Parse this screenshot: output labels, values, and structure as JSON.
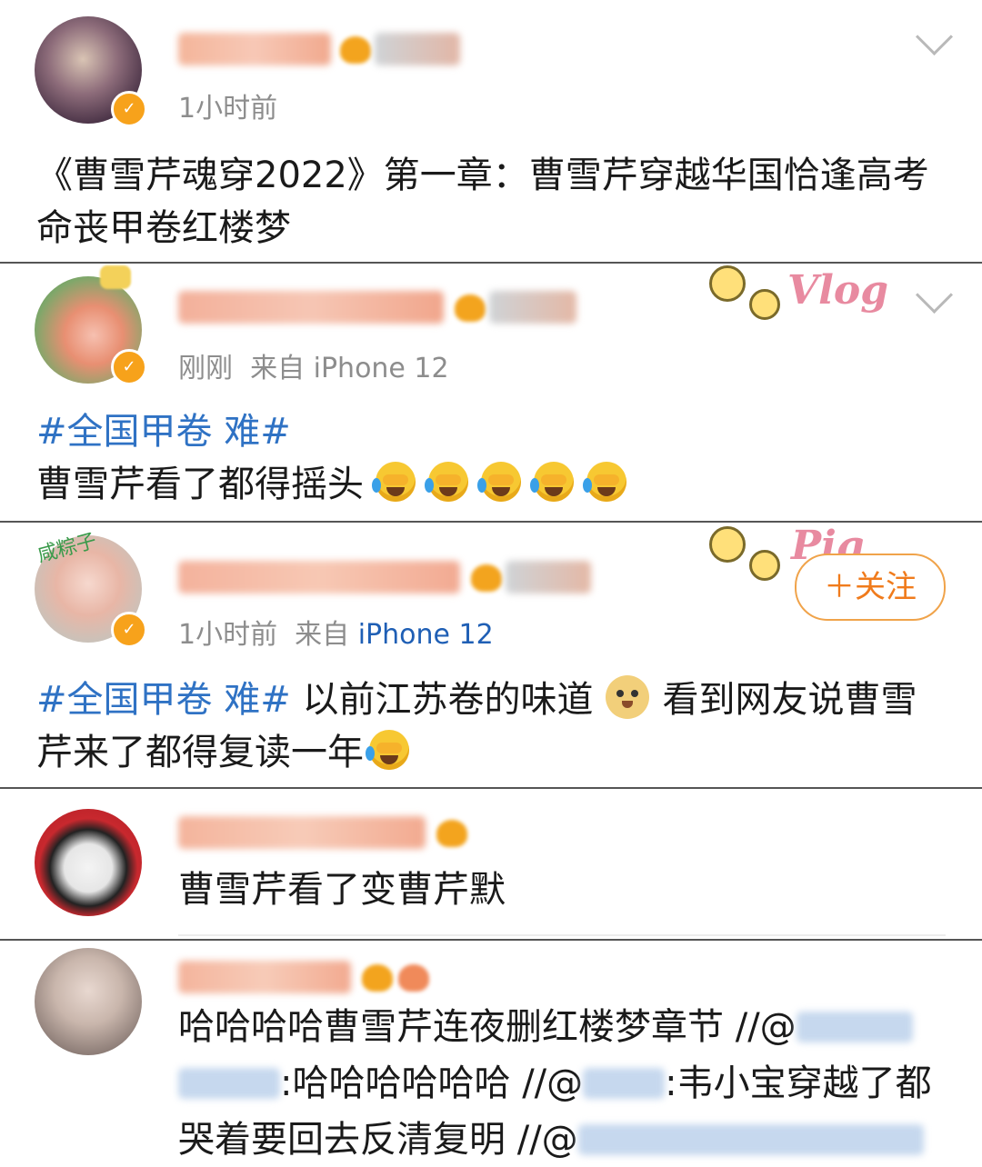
{
  "posts": [
    {
      "time": "1小时前",
      "text": "《曹雪芹魂穿2022》第一章：曹雪芹穿越华国恰逢高考命丧甲卷红楼梦"
    },
    {
      "time": "刚刚",
      "source_prefix": "来自",
      "source": "iPhone 12",
      "hashtag": "#全国甲卷 难#",
      "text": "曹雪芹看了都得摇头",
      "deco_text": "Vlog"
    },
    {
      "time": "1小时前",
      "source_prefix": "来自",
      "source": "iPhone 12",
      "hashtag": "#全国甲卷 难#",
      "text_a": "以前江苏卷的味道",
      "text_b": "看到网友说曹雪芹来了都得复读一年",
      "follow_label": "＋关注",
      "avatar_tag": "咸粽子",
      "deco_text": "Pig"
    },
    {
      "text": "曹雪芹看了变曹芹默"
    },
    {
      "text_a": "哈哈哈哈曹雪芹连夜删红楼梦章节 //@",
      "text_b": ":哈哈哈哈哈哈 //@",
      "text_c": ":韦小宝穿越了都哭着要回去反清复明 //@"
    }
  ],
  "icons": {
    "verified": "verified-badge-icon",
    "member_crown": "crown-icon",
    "expand": "chevron-down-icon",
    "cry_laugh": "laugh-cry-emoji-icon",
    "doge": "doge-emoji-icon"
  },
  "colors": {
    "link_blue": "#2f72c4",
    "follow_orange": "#f07b1c",
    "badge_orange": "#f7a21b"
  }
}
